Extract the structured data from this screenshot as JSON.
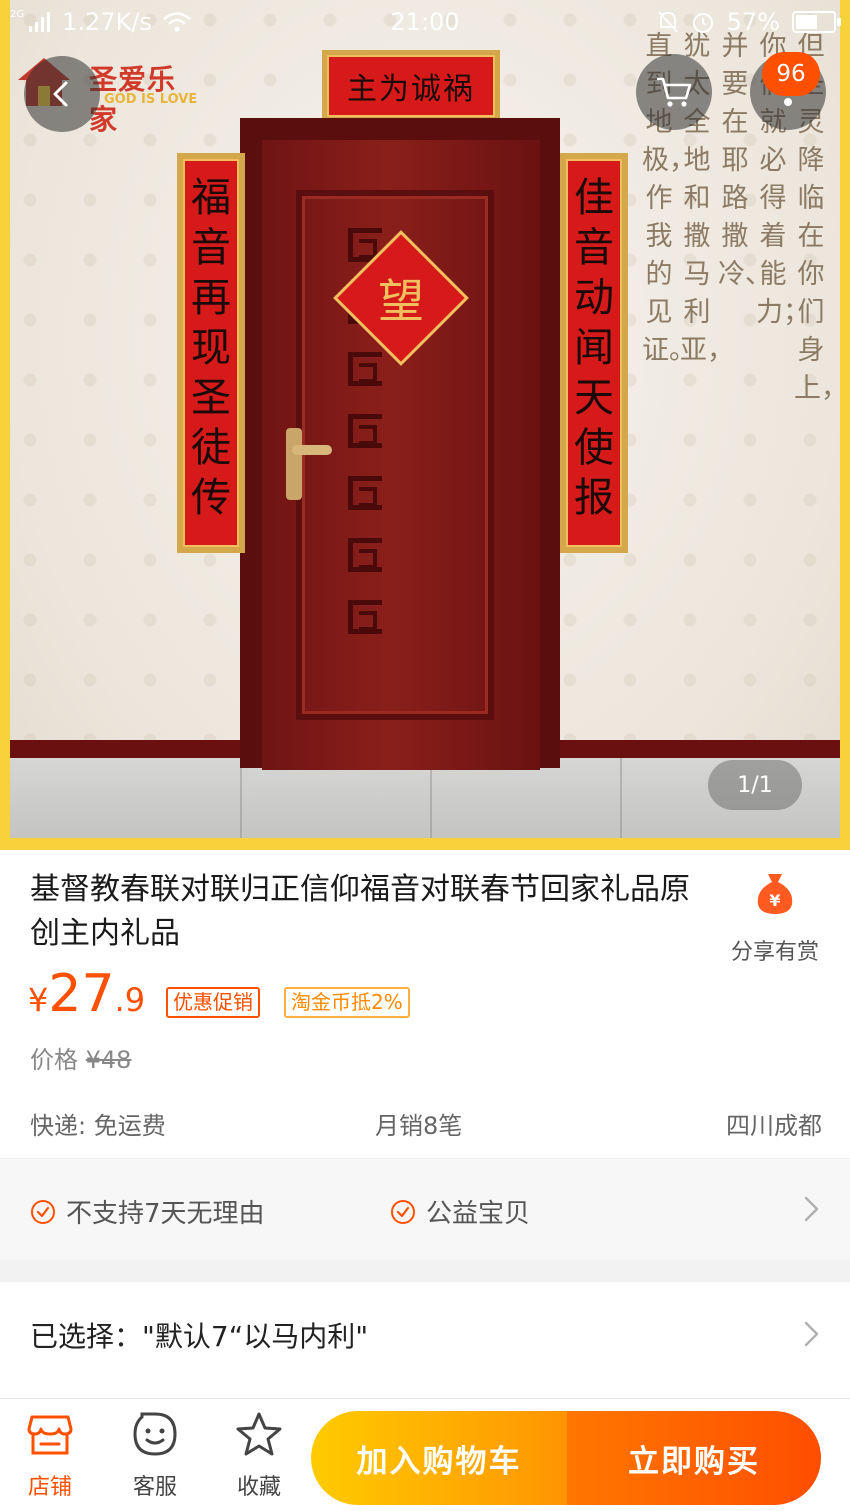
{
  "status_bar": {
    "network_type": "2G",
    "speed": "1.27K/s",
    "time": "21:00",
    "battery_percent": "57%",
    "battery_level": 0.57
  },
  "gallery": {
    "badge_count": "96",
    "page_indicator": "1/1",
    "brand_name": "圣爱乐家",
    "brand_sub": "GOD IS LOVE",
    "banner_top": "主为诚祸",
    "couplet_left": [
      "福",
      "音",
      "再",
      "现",
      "圣",
      "徒",
      "传"
    ],
    "couplet_right": [
      "佳",
      "音",
      "动",
      "闻",
      "天",
      "使",
      "报"
    ],
    "fu": "望",
    "verse_columns": [
      "但圣灵降临在你们身上，",
      "你们就必得着能力；",
      "并要在耶路撒冷、",
      "犹太全地和撒马利亚，",
      "直到地极，作我的见证。"
    ]
  },
  "product": {
    "title": "基督教春联对联归正信仰福音对联春节回家礼品原创主内礼品",
    "share_label": "分享有赏",
    "price_symbol": "¥",
    "price_integer": "27",
    "price_decimal": ".9",
    "tag_promo": "优惠促销",
    "tag_coin": "淘金币抵2%",
    "original_price_label": "价格",
    "original_price": "¥48",
    "shipping": "快递: 免运费",
    "monthly_sales": "月销8笔",
    "location": "四川成都"
  },
  "services": {
    "item1": "不支持7天无理由",
    "item2": "公益宝贝"
  },
  "selection": {
    "text": "已选择：\"默认7“以马内利\""
  },
  "bottom_bar": {
    "shop_label": "店铺",
    "service_label": "客服",
    "favorite_label": "收藏",
    "add_to_cart": "加入购物车",
    "buy_now": "立即购买"
  },
  "colors": {
    "accent": "#ff5000",
    "cart_gradient_start": "#ffcb00",
    "cart_gradient_end": "#ff9402",
    "buy_gradient_start": "#ff7700",
    "buy_gradient_end": "#ff4e00",
    "hero_frame": "#f7d23a"
  },
  "icons": {
    "back": "chevron-left-icon",
    "cart": "cart-icon",
    "more": "more-vertical-icon",
    "share": "money-bag-icon",
    "service_check": "check-circle-icon",
    "shop": "shop-icon",
    "customer_service": "chat-face-icon",
    "favorite": "star-icon"
  }
}
